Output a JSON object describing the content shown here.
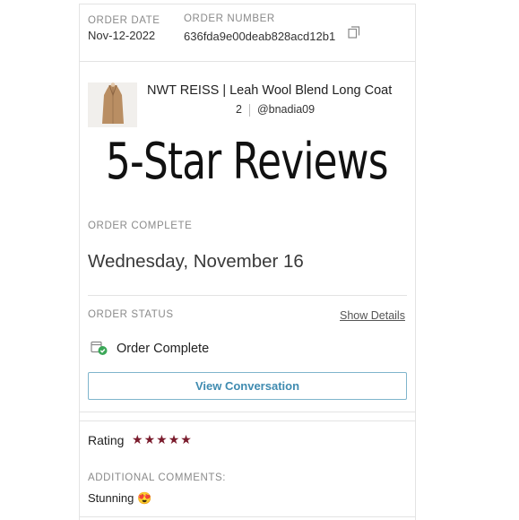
{
  "order": {
    "date_label": "ORDER DATE",
    "date_value": "Nov-12-2022",
    "number_label": "ORDER NUMBER",
    "number_value": "636fda9e00deab828acd12b1"
  },
  "item": {
    "title": "NWT REISS | Leah Wool Blend Long Coat",
    "size": "2",
    "seller": "@bnadia09"
  },
  "overlay": {
    "banner": "5-Star Reviews"
  },
  "completion": {
    "label": "ORDER COMPLETE",
    "date": "Wednesday, November 16"
  },
  "status": {
    "label": "ORDER STATUS",
    "show_details": "Show Details",
    "text": "Order Complete",
    "button": "View Conversation",
    "check_color": "#3aa757"
  },
  "review": {
    "rating_label": "Rating",
    "stars": 5,
    "comments_label": "ADDITIONAL COMMENTS:",
    "comment": "Stunning",
    "emoji": "😍",
    "star_color": "#7a1b2c"
  }
}
